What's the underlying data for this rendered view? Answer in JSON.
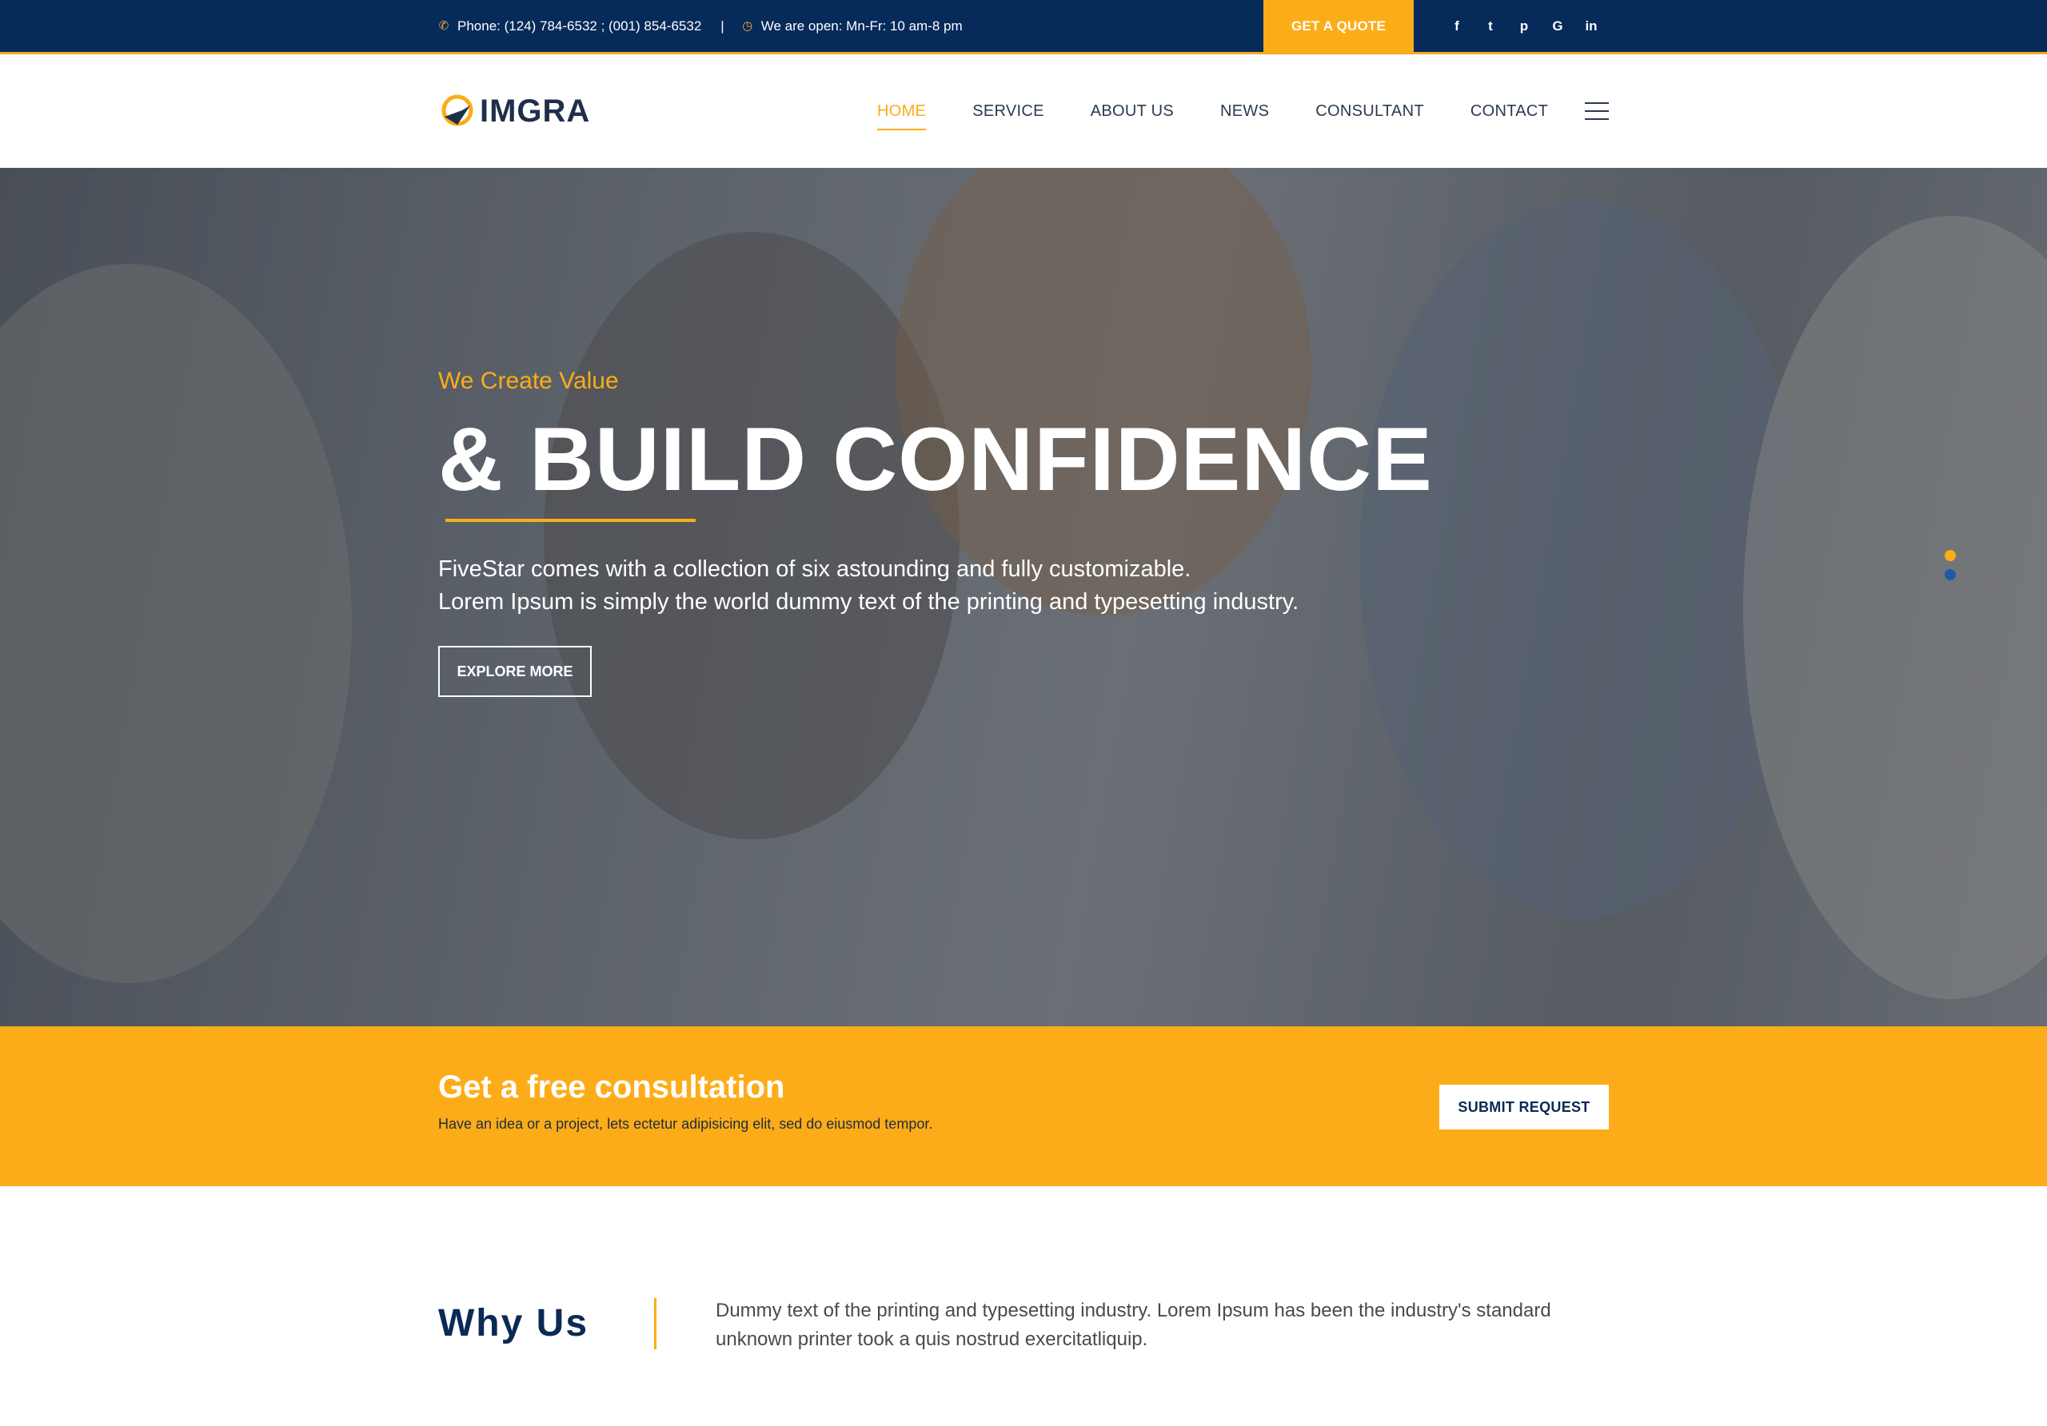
{
  "topbar": {
    "phone": "Phone: (124) 784-6532 ; (001) 854-6532",
    "separator": "|",
    "hours": "We are open: Mn-Fr: 10 am-8 pm",
    "quote_label": "GET A QUOTE",
    "social": [
      {
        "icon": "facebook-icon",
        "glyph": "f"
      },
      {
        "icon": "twitter-icon",
        "glyph": "t"
      },
      {
        "icon": "pinterest-icon",
        "glyph": "p"
      },
      {
        "icon": "google-icon",
        "glyph": "G"
      },
      {
        "icon": "linkedin-icon",
        "glyph": "in"
      }
    ]
  },
  "nav": {
    "logo_text": "IMGRA",
    "items": [
      {
        "label": "HOME",
        "active": true
      },
      {
        "label": "SERVICE",
        "active": false
      },
      {
        "label": "ABOUT US",
        "active": false
      },
      {
        "label": "NEWS",
        "active": false
      },
      {
        "label": "CONSULTANT",
        "active": false
      },
      {
        "label": "CONTACT",
        "active": false
      }
    ]
  },
  "hero": {
    "kicker": "We Create Value",
    "headline": "& BUILD CONFIDENCE",
    "desc_line1": "FiveStar comes with a collection of six astounding and fully customizable.",
    "desc_line2": "Lorem Ipsum is simply the world dummy text of the printing and typesetting industry.",
    "button_label": "EXPLORE MORE",
    "slide_count": 2,
    "active_slide": 1
  },
  "cta": {
    "title": "Get a free consultation",
    "subtitle": "Have an idea or a project, lets ectetur adipisicing elit, sed do eiusmod tempor.",
    "button_label": "SUBMIT REQUEST"
  },
  "why": {
    "title": "Why Us",
    "text": "Dummy text of the printing and typesetting industry. Lorem Ipsum has been the industry's standard unknown printer took a quis nostrud exercitatliquip."
  },
  "colors": {
    "navy": "#062a5a",
    "accent": "#fbad18",
    "dark_text": "#0b2a55"
  }
}
